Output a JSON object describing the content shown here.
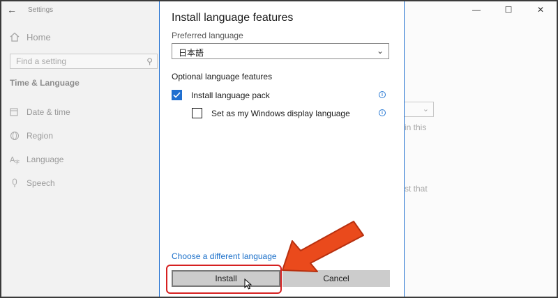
{
  "settings": {
    "title": "Settings",
    "home": "Home",
    "search_placeholder": "Find a setting",
    "section": "Time & Language",
    "nav": [
      {
        "label": "Date & time",
        "icon": "calendar-clock-icon"
      },
      {
        "label": "Region",
        "icon": "globe-icon"
      },
      {
        "label": "Language",
        "icon": "language-icon"
      },
      {
        "label": "Speech",
        "icon": "microphone-icon"
      }
    ],
    "right_text_1": "in this",
    "right_text_2": "st that"
  },
  "dialog": {
    "title": "Install language features",
    "preferred_label": "Preferred language",
    "preferred_value": "日本語",
    "optional_label": "Optional language features",
    "options": [
      {
        "label": "Install language pack",
        "checked": true
      },
      {
        "label": "Set as my Windows display language",
        "checked": false
      }
    ],
    "different_link": "Choose a different language",
    "install_button": "Install",
    "cancel_button": "Cancel"
  },
  "colors": {
    "accent": "#1f6fd0",
    "link": "#1a6fc9",
    "annotation": "#d62020",
    "arrow": "#ea4a1c"
  }
}
